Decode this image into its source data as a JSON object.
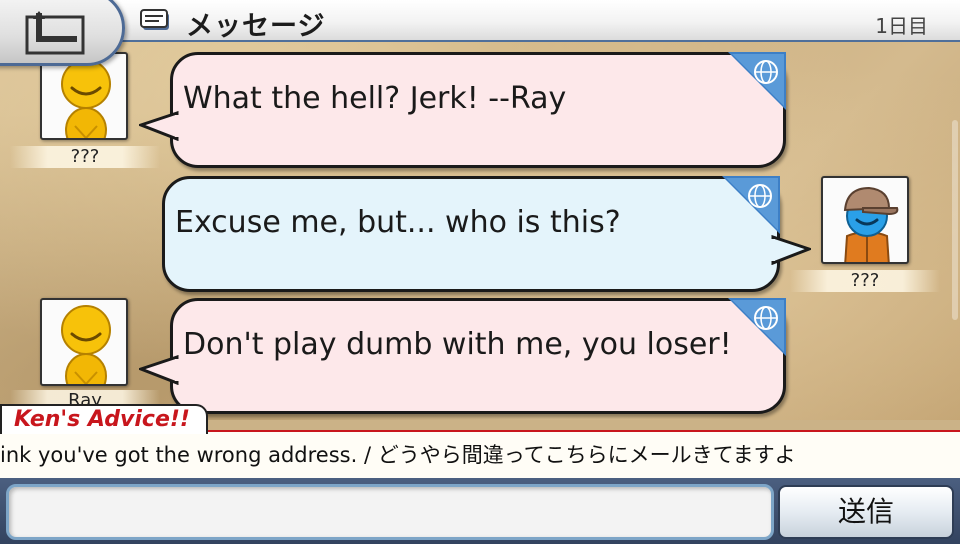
{
  "header": {
    "title": "メッセージ",
    "day": "1日目",
    "back_icon": "back-arrow-icon",
    "mail_icon": "mail-icon"
  },
  "messages": [
    {
      "sender": "???",
      "side": "left",
      "text": "What the hell? Jerk! --Ray",
      "bubble_color": "#fde8ea",
      "avatar": "yellow-smiley-avatar"
    },
    {
      "sender": "???",
      "side": "right",
      "text": "Excuse me, but... who is this?",
      "bubble_color": "#e4f4fb",
      "avatar": "blue-cap-avatar"
    },
    {
      "sender": "Ray",
      "side": "left",
      "text": "Don't play dumb with me, you loser!",
      "bubble_color": "#fde8ea",
      "avatar": "yellow-smiley-avatar"
    }
  ],
  "advice": {
    "title": "Ken's Advice!!",
    "text": "ink you've got the wrong address. / どうやら間違ってこちらにメールきてますよ",
    "title_color": "#c8161d"
  },
  "input": {
    "value": "",
    "placeholder": ""
  },
  "send_button": {
    "label": "送信"
  }
}
